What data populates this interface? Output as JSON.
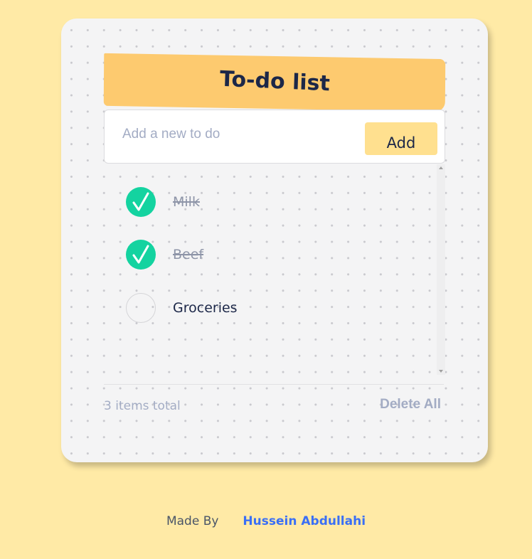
{
  "app": {
    "title": "To-do list"
  },
  "input": {
    "placeholder": "Add a new to do",
    "value": "",
    "add_label": "Add"
  },
  "todos": [
    {
      "label": "Milk",
      "done": true
    },
    {
      "label": "Beef",
      "done": true
    },
    {
      "label": "Groceries",
      "done": false
    }
  ],
  "footer_bar": {
    "items_total": "3 items total",
    "delete_all_label": "Delete All"
  },
  "credit": {
    "made_by": "Made By",
    "author": "Hussein Abdullahi"
  },
  "colors": {
    "background": "#ffeaa6",
    "banner": "#fdca6f",
    "add_button": "#ffe08f",
    "check_done": "#14d3a0",
    "author_link": "#3a6ff5"
  },
  "icons": {
    "check": "checkmark-icon"
  }
}
